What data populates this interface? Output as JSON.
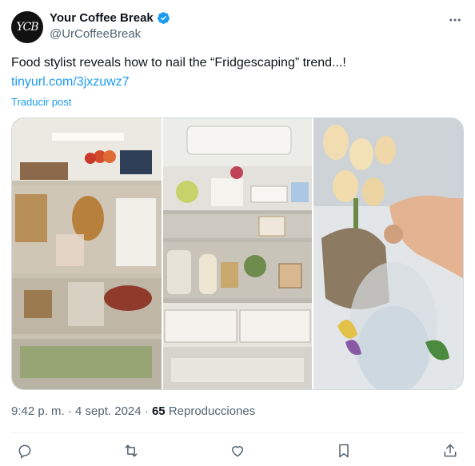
{
  "author": {
    "avatar_initials": "YCB",
    "display_name": "Your Coffee Break",
    "handle": "@UrCoffeeBreak",
    "verified": true
  },
  "tweet": {
    "text": "Food stylist reveals how to nail the “Fridgescaping” trend...!",
    "link": "tinyurl.com/3jxzuwz7",
    "translate_label": "Traducir post"
  },
  "meta": {
    "time": "9:42 p. m.",
    "separator": "·",
    "date": "4 sept. 2024",
    "views_count": "65",
    "views_label": "Reproducciones"
  },
  "icons": {
    "more": "more-icon",
    "verified": "verified-badge-icon",
    "reply": "reply-icon",
    "repost": "repost-icon",
    "like": "like-icon",
    "bookmark": "bookmark-icon",
    "share": "share-icon"
  },
  "colors": {
    "text": "#0f1419",
    "secondary": "#536471",
    "accent": "#1d9bf0",
    "border": "#cfd9de"
  }
}
